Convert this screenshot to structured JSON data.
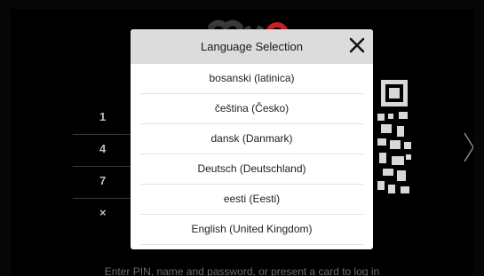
{
  "background": {
    "logo_text": "myQ",
    "keypad": [
      "1",
      "4",
      "7",
      "×"
    ],
    "footer_text": "Enter PIN, name and password, or present a card to log in"
  },
  "dialog": {
    "title": "Language Selection",
    "close_icon": "close-icon",
    "languages": [
      "bosanski (latinica)",
      "čeština (Česko)",
      "dansk (Danmark)",
      "Deutsch (Deutschland)",
      "eesti (Eesti)",
      "English (United Kingdom)"
    ]
  },
  "colors": {
    "logo_accent": "#d0202a",
    "header_bg": "#dcdcdc"
  }
}
